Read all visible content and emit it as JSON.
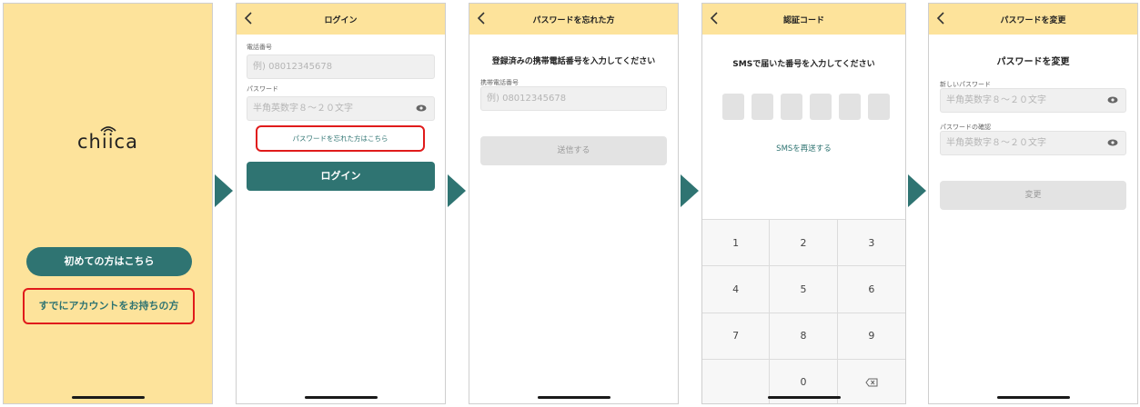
{
  "screen1": {
    "logo_text": "chiica",
    "first_time_button": "初めての方はこちら",
    "have_account_link": "すでにアカウントをお持ちの方"
  },
  "screen2": {
    "title": "ログイン",
    "phone_label": "電話番号",
    "phone_placeholder": "例) 08012345678",
    "password_label": "パスワード",
    "password_placeholder": "半角英数字８〜２０文字",
    "forgot_link": "パスワードを忘れた方はこちら",
    "login_button": "ログイン"
  },
  "screen3": {
    "title": "パスワードを忘れた方",
    "heading": "登録済みの携帯電話番号を入力してください",
    "phone_label": "携帯電話番号",
    "phone_placeholder": "例) 08012345678",
    "send_button": "送信する"
  },
  "screen4": {
    "title": "認証コード",
    "heading": "SMSで届いた番号を入力してください",
    "code_length": 6,
    "resend_link": "SMSを再送する",
    "keys": [
      "1",
      "2",
      "3",
      "4",
      "5",
      "6",
      "7",
      "8",
      "9",
      "",
      "0",
      "⌫"
    ]
  },
  "screen5": {
    "title": "パスワードを変更",
    "heading": "パスワードを変更",
    "new_password_label": "新しいパスワード",
    "new_password_placeholder": "半角英数字８〜２０文字",
    "confirm_label": "パスワードの確認",
    "confirm_placeholder": "半角英数字８〜２０文字",
    "change_button": "変更"
  },
  "colors": {
    "header_yellow": "#fde39b",
    "teal": "#2f7472",
    "highlight_red": "#e01b1b",
    "disabled_gray": "#e3e3e3"
  },
  "icons": [
    "back-chevron-icon",
    "eye-icon",
    "backspace-icon",
    "flow-arrow-icon"
  ]
}
